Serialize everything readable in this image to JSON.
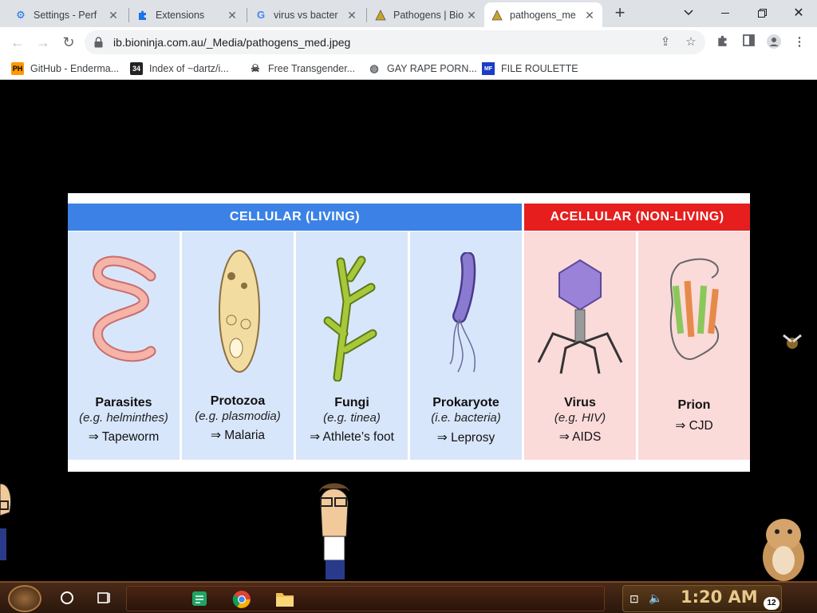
{
  "tabs": [
    {
      "title": "Settings - Perf",
      "icon": "gear-icon"
    },
    {
      "title": "Extensions",
      "icon": "puzzle-icon"
    },
    {
      "title": "virus vs bacter",
      "icon": "google-icon"
    },
    {
      "title": "Pathogens | Bio",
      "icon": "bioninja-icon"
    },
    {
      "title": "pathogens_me",
      "icon": "bioninja-icon"
    }
  ],
  "address_bar": {
    "url": "ib.bioninja.com.au/_Media/pathogens_med.jpeg"
  },
  "bookmarks": [
    {
      "label": "GitHub - Enderma...",
      "icon_text": "PH"
    },
    {
      "label": "Index of ~dartz/i...",
      "icon_text": "34"
    },
    {
      "label": "Free Transgender...",
      "icon_text": ""
    },
    {
      "label": "GAY RAPE PORN...",
      "icon_text": ""
    },
    {
      "label": "FILE ROULETTE",
      "icon_text": "MF"
    }
  ],
  "infographic": {
    "cellular_header": "CELLULAR  (LIVING)",
    "acellular_header": "ACELLULAR  (NON-LIVING)",
    "colors": {
      "cellular": "#3c82e6",
      "acellular": "#e61e1e",
      "cellular_panel": "#d8e6fb",
      "acellular_panel": "#fbdada"
    },
    "columns": [
      {
        "name": "Parasites",
        "example": "(e.g. helminthes)",
        "outcome": "⇒ Tapeworm"
      },
      {
        "name": "Protozoa",
        "example": "(e.g. plasmodia)",
        "outcome": "⇒ Malaria"
      },
      {
        "name": "Fungi",
        "example": "(e.g. tinea)",
        "outcome": "⇒ Athlete’s foot"
      },
      {
        "name": "Prokaryote",
        "example": "(i.e. bacteria)",
        "outcome": "⇒ Leprosy"
      },
      {
        "name": "Virus",
        "example": "(e.g. HIV)",
        "outcome": "⇒ AIDS"
      },
      {
        "name": "Prion",
        "example": "",
        "outcome": "⇒ CJD"
      }
    ]
  },
  "taskbar": {
    "clock": "1:20 AM",
    "notification_count": "12"
  }
}
